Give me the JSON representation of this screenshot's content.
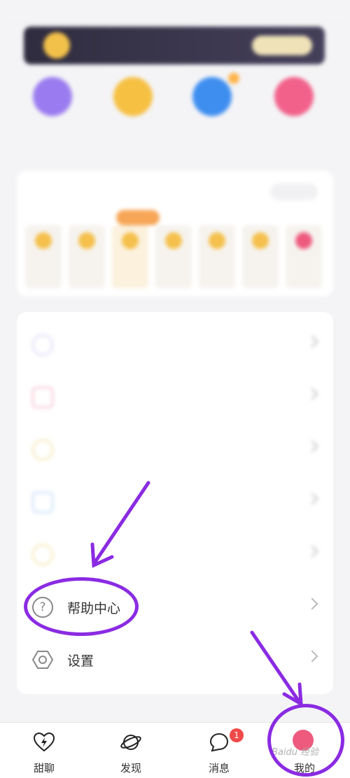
{
  "status_bar": {
    "left": "",
    "right": ""
  },
  "banner": {
    "text": "",
    "button": ""
  },
  "quick_actions": [
    {
      "label": "",
      "icon": "crown-icon",
      "color": "#9b7cf0"
    },
    {
      "label": "",
      "icon": "gift-icon",
      "color": "#f6c043"
    },
    {
      "label": "",
      "icon": "wallet-icon",
      "color": "#3e8ef0",
      "badge": ""
    },
    {
      "label": "",
      "icon": "reward-icon",
      "color": "#f2618a"
    }
  ],
  "signin": {
    "title": "",
    "rule": "",
    "badge": "",
    "days": [
      "",
      "",
      "",
      "",
      "",
      "",
      ""
    ]
  },
  "menu": {
    "items": [
      {
        "label": "",
        "icon": "dynamic-icon",
        "color": "#d8d0f0"
      },
      {
        "label": "",
        "icon": "heart-icon",
        "color": "#f3b8c9"
      },
      {
        "label": "",
        "icon": "star-icon",
        "color": "#f2e1a5"
      },
      {
        "label": "",
        "icon": "bind-icon",
        "color": "#bcd7f5"
      },
      {
        "label": "",
        "icon": "medal-icon",
        "color": "#f2e1a5"
      },
      {
        "label": "帮助中心",
        "icon": "help-circle-icon",
        "color": "#888888"
      },
      {
        "label": "设置",
        "icon": "settings-hexagon-icon",
        "color": "#888888"
      }
    ]
  },
  "tabbar": {
    "tabs": [
      {
        "label": "甜聊",
        "icon": "heart-bolt-icon"
      },
      {
        "label": "发现",
        "icon": "planet-icon"
      },
      {
        "label": "消息",
        "icon": "chat-bubble-icon",
        "badge": "1"
      },
      {
        "label": "我的",
        "icon": "avatar"
      }
    ]
  },
  "watermark": "Baidu 经验",
  "colors": {
    "annotation": "#8a2be2",
    "badge_red": "#ef4a4a"
  }
}
